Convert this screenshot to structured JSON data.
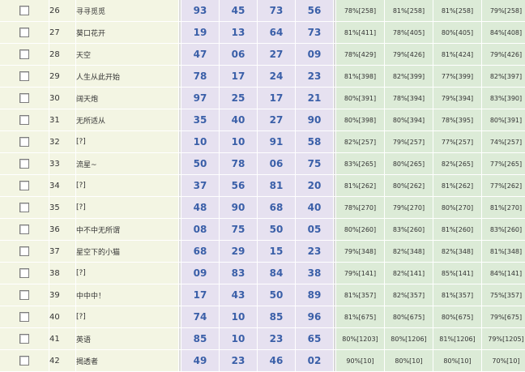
{
  "rows": [
    {
      "num": "26",
      "name": "寻寻觅觅",
      "v": [
        "93",
        "45",
        "73",
        "56"
      ],
      "p": [
        "78%[258]",
        "81%[258]",
        "81%[258]",
        "79%[258]"
      ]
    },
    {
      "num": "27",
      "name": "葵口花开",
      "v": [
        "19",
        "13",
        "64",
        "73"
      ],
      "p": [
        "81%[411]",
        "78%[405]",
        "80%[405]",
        "84%[408]"
      ]
    },
    {
      "num": "28",
      "name": "天空",
      "v": [
        "47",
        "06",
        "27",
        "09"
      ],
      "p": [
        "78%[429]",
        "79%[426]",
        "81%[424]",
        "79%[426]"
      ]
    },
    {
      "num": "29",
      "name": "人生从此开始",
      "v": [
        "78",
        "17",
        "24",
        "23"
      ],
      "p": [
        "81%[398]",
        "82%[399]",
        "77%[399]",
        "82%[397]"
      ]
    },
    {
      "num": "30",
      "name": "阔天炮",
      "v": [
        "97",
        "25",
        "17",
        "21"
      ],
      "p": [
        "80%[391]",
        "78%[394]",
        "79%[394]",
        "83%[390]"
      ]
    },
    {
      "num": "31",
      "name": "无所适从",
      "v": [
        "35",
        "40",
        "27",
        "90"
      ],
      "p": [
        "80%[398]",
        "80%[394]",
        "78%[395]",
        "80%[391]"
      ]
    },
    {
      "num": "32",
      "name": "[?]",
      "v": [
        "10",
        "10",
        "91",
        "58"
      ],
      "p": [
        "82%[257]",
        "79%[257]",
        "77%[257]",
        "74%[257]"
      ]
    },
    {
      "num": "33",
      "name": "流星~",
      "v": [
        "50",
        "78",
        "06",
        "75"
      ],
      "p": [
        "83%[265]",
        "80%[265]",
        "82%[265]",
        "77%[265]"
      ]
    },
    {
      "num": "34",
      "name": "[?]",
      "v": [
        "37",
        "56",
        "81",
        "20"
      ],
      "p": [
        "81%[262]",
        "80%[262]",
        "81%[262]",
        "77%[262]"
      ]
    },
    {
      "num": "35",
      "name": "[?]",
      "v": [
        "48",
        "90",
        "68",
        "40"
      ],
      "p": [
        "78%[270]",
        "79%[270]",
        "80%[270]",
        "81%[270]"
      ]
    },
    {
      "num": "36",
      "name": "中不中无所谓",
      "v": [
        "08",
        "75",
        "50",
        "05"
      ],
      "p": [
        "80%[260]",
        "83%[260]",
        "81%[260]",
        "83%[260]"
      ]
    },
    {
      "num": "37",
      "name": "星空下的小猫",
      "v": [
        "68",
        "29",
        "15",
        "23"
      ],
      "p": [
        "79%[348]",
        "82%[348]",
        "82%[348]",
        "81%[348]"
      ]
    },
    {
      "num": "38",
      "name": "[?]",
      "v": [
        "09",
        "83",
        "84",
        "38"
      ],
      "p": [
        "79%[141]",
        "82%[141]",
        "85%[141]",
        "84%[141]"
      ]
    },
    {
      "num": "39",
      "name": "中中中！",
      "v": [
        "17",
        "43",
        "50",
        "89"
      ],
      "p": [
        "81%[357]",
        "82%[357]",
        "81%[357]",
        "75%[357]"
      ]
    },
    {
      "num": "40",
      "name": "[?]",
      "v": [
        "74",
        "10",
        "85",
        "96"
      ],
      "p": [
        "81%[675]",
        "80%[675]",
        "80%[675]",
        "79%[675]"
      ]
    },
    {
      "num": "41",
      "name": "英语",
      "v": [
        "85",
        "10",
        "23",
        "65"
      ],
      "p": [
        "80%[1203]",
        "80%[1206]",
        "81%[1206]",
        "79%[1205]"
      ]
    },
    {
      "num": "42",
      "name": "揭透者",
      "v": [
        "49",
        "23",
        "46",
        "02"
      ],
      "p": [
        "90%[10]",
        "80%[10]",
        "80%[10]",
        "70%[10]"
      ]
    }
  ]
}
